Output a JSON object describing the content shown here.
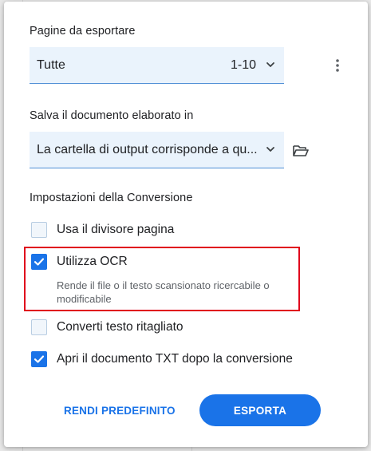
{
  "pages": {
    "label": "Pagine da esportare",
    "value": "Tutte",
    "range": "1-10"
  },
  "save": {
    "label": "Salva il documento elaborato in",
    "value": "La cartella di output corrisponde a qu..."
  },
  "conversion": {
    "label": "Impostazioni della Conversione",
    "options": [
      {
        "label": "Usa il divisore pagina",
        "checked": false
      },
      {
        "label": "Utilizza OCR",
        "checked": true,
        "description": "Rende il file o il testo scansionato ricercabile o modificabile"
      },
      {
        "label": "Converti testo ritagliato",
        "checked": false
      },
      {
        "label": "Apri il documento TXT dopo la conversione",
        "checked": true
      }
    ]
  },
  "footer": {
    "default_label": "RENDI PREDEFINITO",
    "export_label": "ESPORTA"
  },
  "icons": {
    "more": "more-vertical-icon",
    "folder": "folder-open-icon",
    "chevron": "chevron-down-icon",
    "check": "check-icon"
  },
  "colors": {
    "accent": "#1a73e8",
    "highlight": "#e0001b",
    "field_background": "#eaf3fc"
  }
}
